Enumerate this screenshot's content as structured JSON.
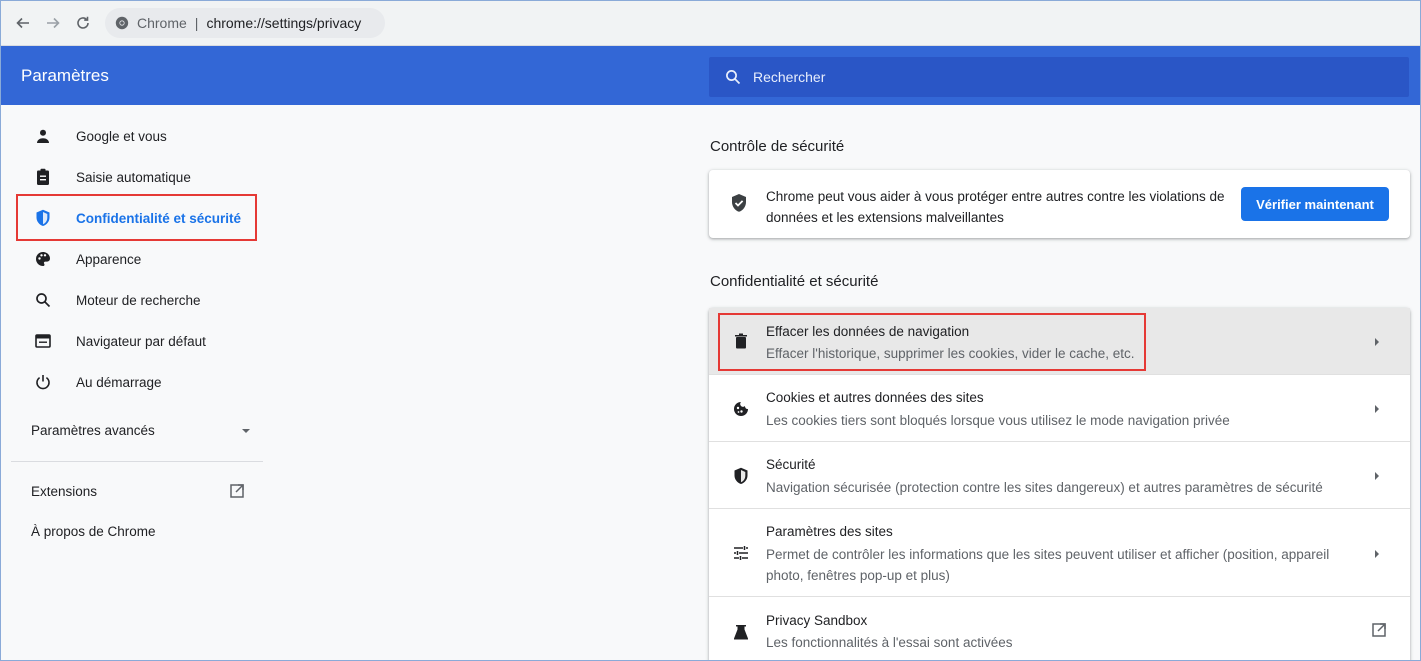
{
  "browser": {
    "site_name": "Chrome",
    "separator": "|",
    "url": "chrome://settings/privacy"
  },
  "header": {
    "title": "Paramètres",
    "search_placeholder": "Rechercher"
  },
  "sidebar": {
    "items": [
      {
        "label": "Google et vous",
        "icon": "person-icon"
      },
      {
        "label": "Saisie automatique",
        "icon": "clipboard-icon"
      },
      {
        "label": "Confidentialité et sécurité",
        "icon": "shield-icon",
        "active": true
      },
      {
        "label": "Apparence",
        "icon": "palette-icon"
      },
      {
        "label": "Moteur de recherche",
        "icon": "search-icon"
      },
      {
        "label": "Navigateur par défaut",
        "icon": "browser-icon"
      },
      {
        "label": "Au démarrage",
        "icon": "power-icon"
      }
    ],
    "advanced_label": "Paramètres avancés",
    "extensions_label": "Extensions",
    "about_label": "À propos de Chrome"
  },
  "main": {
    "safety": {
      "title": "Contrôle de sécurité",
      "text": "Chrome peut vous aider à vous protéger entre autres contre les violations de données et les extensions malveillantes",
      "button": "Vérifier maintenant"
    },
    "privacy": {
      "title": "Confidentialité et sécurité",
      "rows": [
        {
          "title": "Effacer les données de navigation",
          "subtitle": "Effacer l'historique, supprimer les cookies, vider le cache, etc.",
          "icon": "trash-icon"
        },
        {
          "title": "Cookies et autres données des sites",
          "subtitle": "Les cookies tiers sont bloqués lorsque vous utilisez le mode navigation privée",
          "icon": "cookie-icon"
        },
        {
          "title": "Sécurité",
          "subtitle": "Navigation sécurisée (protection contre les sites dangereux) et autres paramètres de sécurité",
          "icon": "shield-icon"
        },
        {
          "title": "Paramètres des sites",
          "subtitle": "Permet de contrôler les informations que les sites peuvent utiliser et afficher (position, appareil photo, fenêtres pop-up et plus)",
          "icon": "tune-icon"
        },
        {
          "title": "Privacy Sandbox",
          "subtitle": "Les fonctionnalités à l'essai sont activées",
          "icon": "flask-icon"
        }
      ]
    }
  },
  "colors": {
    "header_blue": "#3367d6",
    "search_blue": "#2a56c6",
    "accent": "#1a73e8",
    "highlight_red": "#e53935"
  }
}
